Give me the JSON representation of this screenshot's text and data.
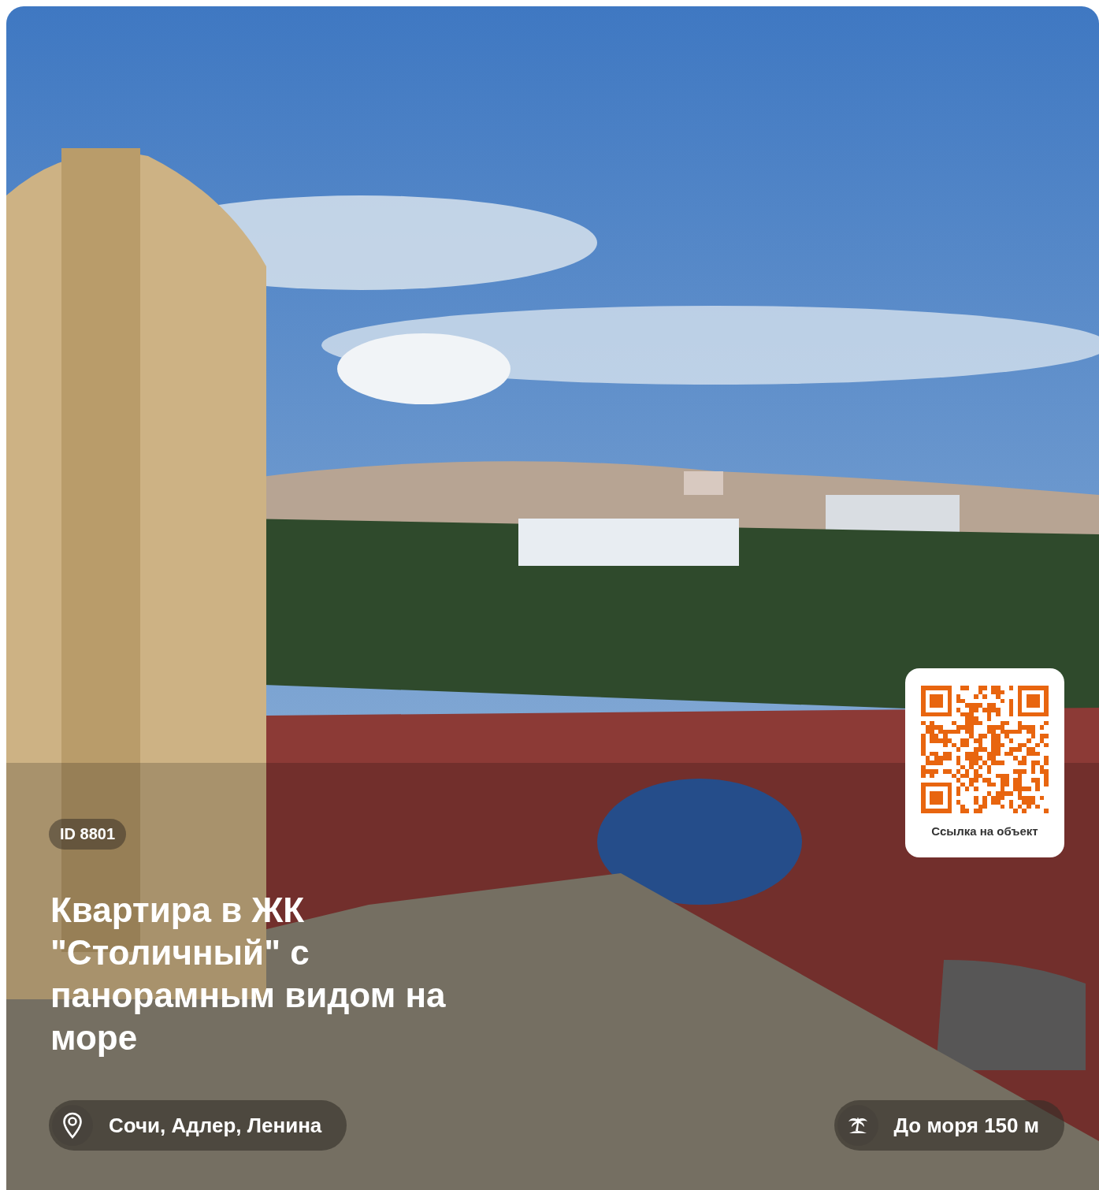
{
  "listing": {
    "id_badge": "ID 8801",
    "title": "Квартира в ЖК \"Столичный\" с панорамным видом на море",
    "location": "Сочи, Адлер, Ленина",
    "sea_distance": "До моря 150 м",
    "qr": {
      "caption": "Ссылка на объект"
    }
  }
}
